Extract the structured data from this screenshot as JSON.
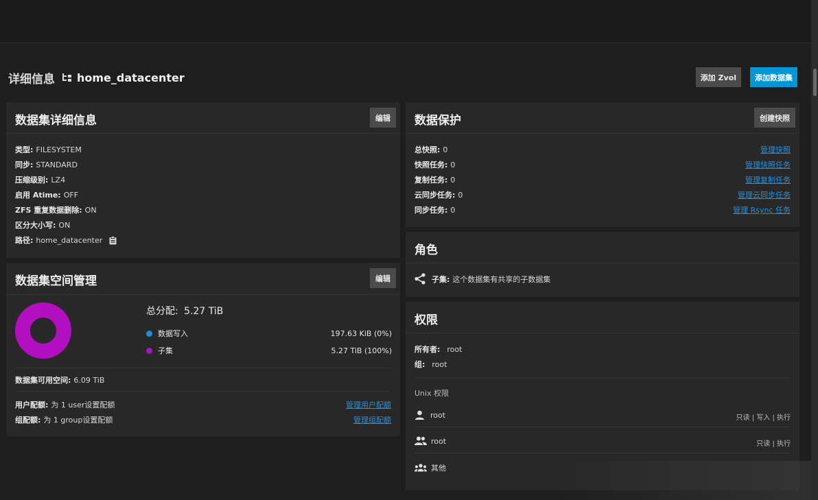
{
  "header": {
    "title": "详细信息",
    "path": "home_datacenter",
    "add_zvol": "添加 Zvol",
    "add_dataset": "添加数据集"
  },
  "details": {
    "title": "数据集详细信息",
    "edit": "编辑",
    "rows": [
      {
        "label": "类型:",
        "value": "FILESYSTEM"
      },
      {
        "label": "同步:",
        "value": "STANDARD"
      },
      {
        "label": "压缩级别:",
        "value": "LZ4"
      },
      {
        "label": "启用 Atime:",
        "value": "OFF"
      },
      {
        "label": "ZFS 重复数据删除:",
        "value": "ON"
      },
      {
        "label": "区分大小写:",
        "value": "ON"
      },
      {
        "label": "路径:",
        "value": "home_datacenter"
      }
    ]
  },
  "space": {
    "title": "数据集空间管理",
    "edit": "编辑",
    "total_label": "总分配:",
    "total_value": "5.27 TiB",
    "legend": [
      {
        "name": "数据写入",
        "value": "197.63 KiB (0%)",
        "color": "#1a8fd8",
        "fraction": 0.0
      },
      {
        "name": "子集",
        "value": "5.27 TiB (100%)",
        "color": "#b20fc1",
        "fraction": 1.0
      }
    ],
    "available_label": "数据集可用空间:",
    "available_value": "6.09 TiB",
    "user_quota_label": "用户配额:",
    "user_quota_value": "为 1 user设置配额",
    "user_quota_link": "管理用户配额",
    "group_quota_label": "组配额:",
    "group_quota_value": "为 1 group设置配额",
    "group_quota_link": "管理组配额"
  },
  "protection": {
    "title": "数据保护",
    "create_snapshot": "创建快照",
    "rows": [
      {
        "label": "总快照:",
        "value": "0",
        "link": "管理快照"
      },
      {
        "label": "快照任务:",
        "value": "0",
        "link": "管理快照任务"
      },
      {
        "label": "复制任务:",
        "value": "0",
        "link": "管理复制任务"
      },
      {
        "label": "云同步任务:",
        "value": "0",
        "link": "管理云同步任务"
      },
      {
        "label": "同步任务:",
        "value": "0",
        "link": "管理 Rsync 任务"
      }
    ]
  },
  "roles": {
    "title": "角色",
    "label": "子集:",
    "value": "这个数据集有共享的子数据集"
  },
  "permissions": {
    "title": "权限",
    "owner_label": "所有者:",
    "owner_value": "root",
    "group_label": "组:",
    "group_value": "root",
    "unix_label": "Unix 权限",
    "entries": [
      {
        "icon": "person-icon",
        "name": "root",
        "perms": "只读 | 写入 | 执行"
      },
      {
        "icon": "group-icon",
        "name": "root",
        "perms": "只读 | 执行"
      },
      {
        "icon": "others-icon",
        "name": "其他",
        "perms": ""
      }
    ]
  }
}
